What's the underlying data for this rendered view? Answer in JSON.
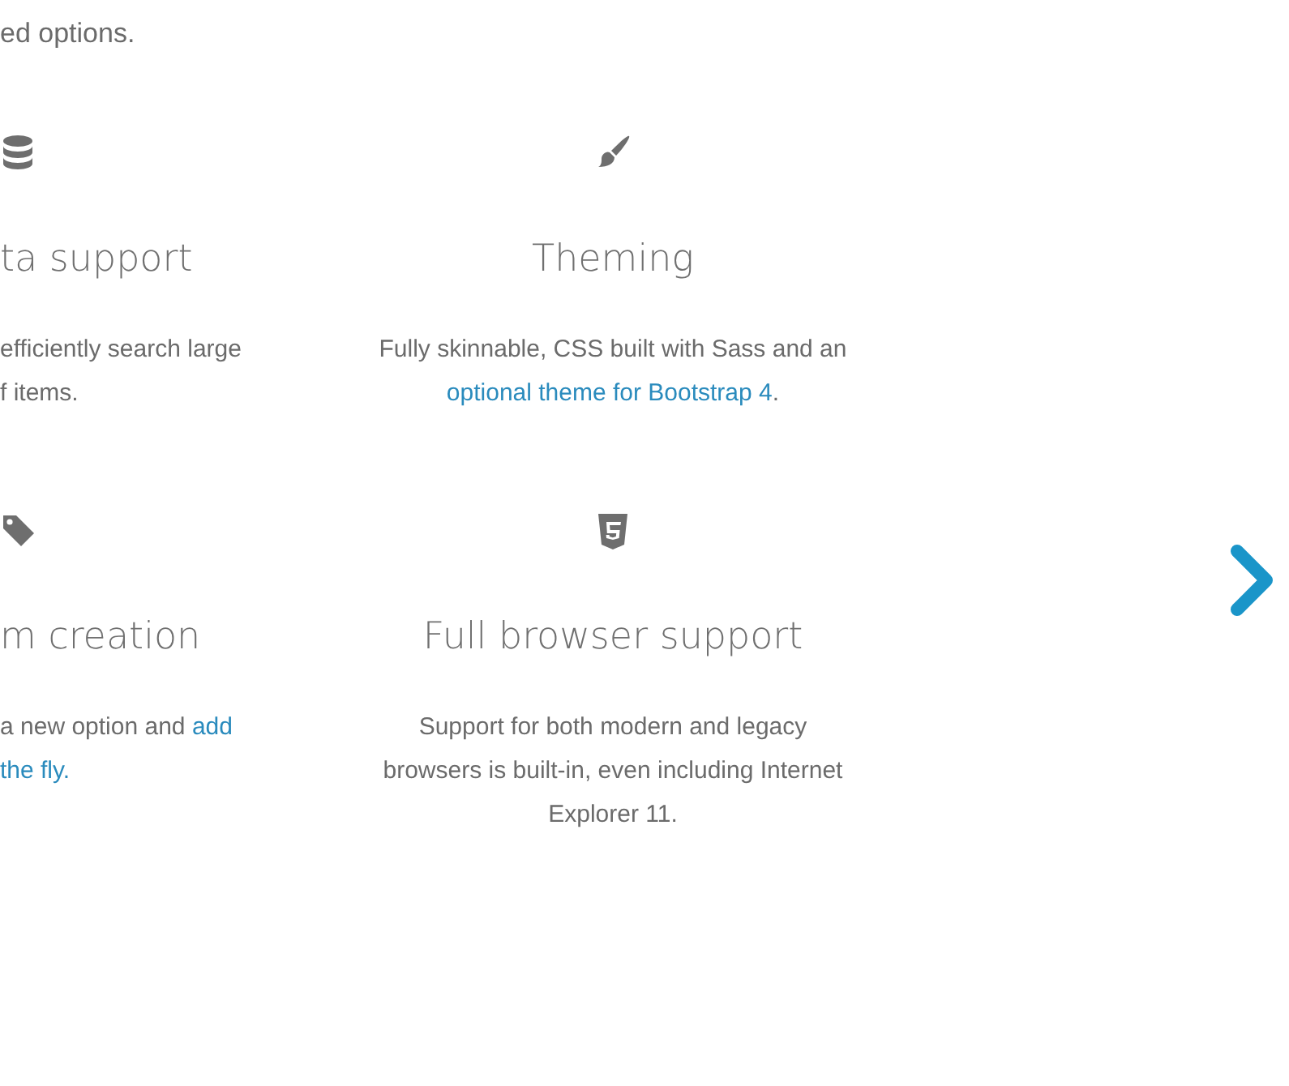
{
  "intro": "ed options.",
  "features": [
    {
      "title": "ta support",
      "lines": [
        [
          {
            "text": "efficiently search large",
            "link": false
          }
        ],
        [
          {
            "text": "f items.",
            "link": false
          }
        ]
      ]
    },
    {
      "title": "Theming",
      "lines": [
        [
          {
            "text": "Fully skinnable, CSS built with Sass and an",
            "link": false
          }
        ],
        [
          {
            "text": "optional theme for Bootstrap 4",
            "link": true
          },
          {
            "text": ".",
            "link": false
          }
        ]
      ]
    },
    {
      "title": "m creation",
      "lines": [
        [
          {
            "text": "a new option and ",
            "link": false
          },
          {
            "text": "add",
            "link": true
          }
        ],
        [
          {
            "text": "the fly.",
            "link": true
          }
        ]
      ]
    },
    {
      "title": "Full browser support",
      "lines": [
        [
          {
            "text": "Support for both modern and legacy",
            "link": false
          }
        ],
        [
          {
            "text": "browsers is built-in, even including Internet",
            "link": false
          }
        ],
        [
          {
            "text": "Explorer 11.",
            "link": false
          }
        ]
      ]
    }
  ]
}
